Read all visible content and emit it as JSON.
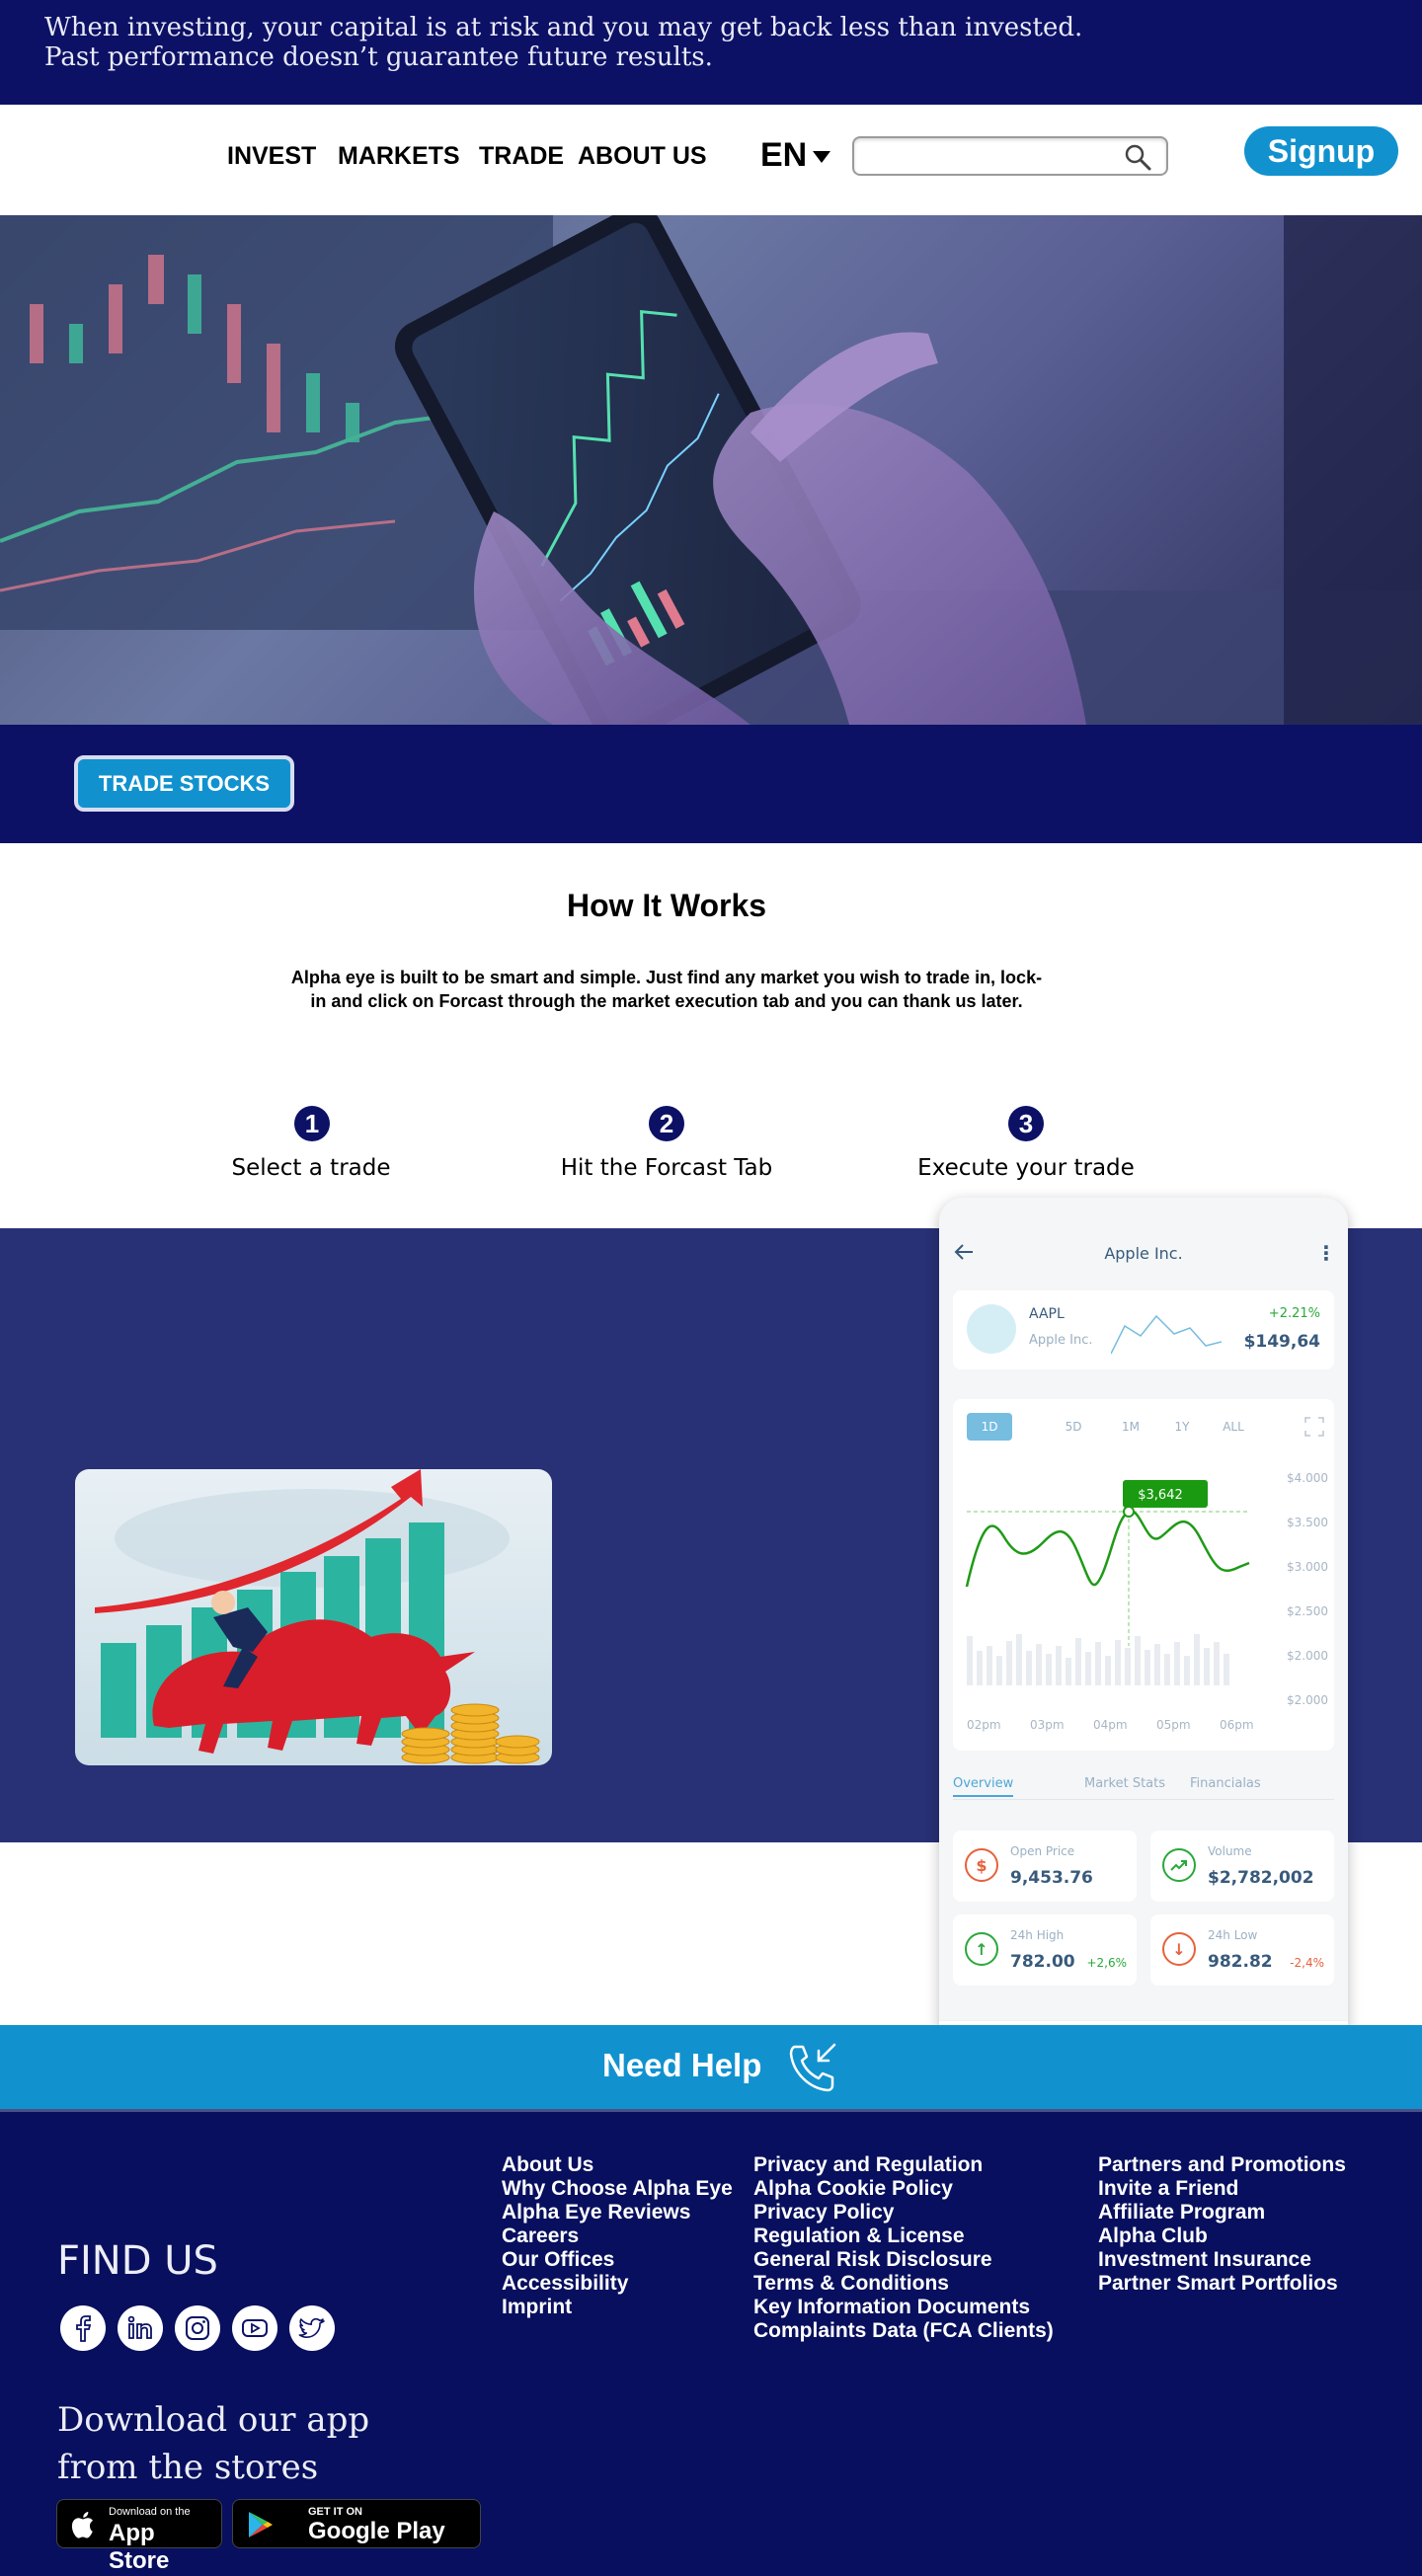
{
  "risk_banner": {
    "line1": "When investing, your capital is at risk and you may get back less than invested.",
    "line2": "Past performance doesn’t guarantee future results."
  },
  "nav": {
    "items": [
      "INVEST",
      "MARKETS",
      "TRADE",
      "ABOUT US"
    ],
    "language": "EN",
    "search_value": "",
    "search_icon": "search-icon",
    "signup_label": "Signup"
  },
  "hero": {
    "cta_label": "TRADE STOCKS"
  },
  "how_it_works": {
    "title": "How It Works",
    "description": "Alpha eye is built to be smart and simple. Just find any market you wish to trade in, lock-in and click on Forcast through the market execution tab and you can thank us later.",
    "steps": [
      {
        "number": "1",
        "label": "Select a trade"
      },
      {
        "number": "2",
        "label": "Hit the Forcast Tab"
      },
      {
        "number": "3",
        "label": "Execute your trade"
      }
    ]
  },
  "phone": {
    "title": "Apple Inc.",
    "ticker": "AAPL",
    "company": "Apple Inc.",
    "change": "+2.21%",
    "price": "$149,64",
    "ranges": [
      "1D",
      "5D",
      "1M",
      "1Y",
      "ALL"
    ],
    "active_range": "1D",
    "tooltip": "$3,642",
    "y_ticks": [
      "$4.000",
      "$3.500",
      "$3.000",
      "$2.500",
      "$2.000",
      "$2.000"
    ],
    "x_ticks": [
      "02pm",
      "03pm",
      "04pm",
      "05pm",
      "06pm"
    ],
    "tabs": [
      "Overview",
      "Market Stats",
      "Financialas"
    ],
    "stats": [
      {
        "label": "Open Price",
        "value": "9,453.76",
        "pct": "",
        "icon": "dollar-icon",
        "color": "#e8613c"
      },
      {
        "label": "Volume",
        "value": "$2,782,002",
        "pct": "",
        "icon": "trend-up-icon",
        "color": "#2aa83b"
      },
      {
        "label": "24h High",
        "value": "782.00",
        "pct": "+2,6%",
        "icon": "arrow-up-icon",
        "color": "#2aa83b"
      },
      {
        "label": "24h Low",
        "value": "982.82",
        "pct": "-2,4%",
        "icon": "arrow-down-icon",
        "color": "#e8613c"
      }
    ],
    "colors": {
      "line": "#1f9a16",
      "tooltip": "#1a9a10",
      "accent": "#4ea6d6"
    }
  },
  "help": {
    "label": "Need Help",
    "icon": "phone-incoming-icon"
  },
  "footer": {
    "col1": [
      "About Us",
      "Why Choose Alpha Eye",
      "Alpha Eye Reviews",
      "Careers",
      "Our Offices",
      "Accessibility",
      "Imprint"
    ],
    "col2": [
      "Privacy and Regulation",
      "Alpha Cookie Policy",
      "Privacy Policy",
      "Regulation & License",
      "General Risk Disclosure",
      "Terms & Conditions",
      "Key Information Documents",
      "Complaints Data (FCA Clients)"
    ],
    "col3": [
      "Partners and Promotions",
      "Invite a Friend",
      "Affiliate Program",
      "Alpha Club",
      "Investment Insurance",
      "Partner Smart Portfolios"
    ],
    "find_us": "FIND US",
    "social_icons": [
      "facebook-icon",
      "linkedin-icon",
      "instagram-icon",
      "youtube-icon",
      "twitter-icon"
    ],
    "download_line1": "Download our app",
    "download_line2": "from the stores",
    "app_store_small": "Download on the",
    "app_store_big": "App Store",
    "google_play_small": "GET IT ON",
    "google_play_big": "Google Play"
  },
  "colors": {
    "navy": "#0c1166",
    "blue_section": "#283076",
    "accent_blue": "#1192cf",
    "footer_bg": "#070f5e"
  }
}
